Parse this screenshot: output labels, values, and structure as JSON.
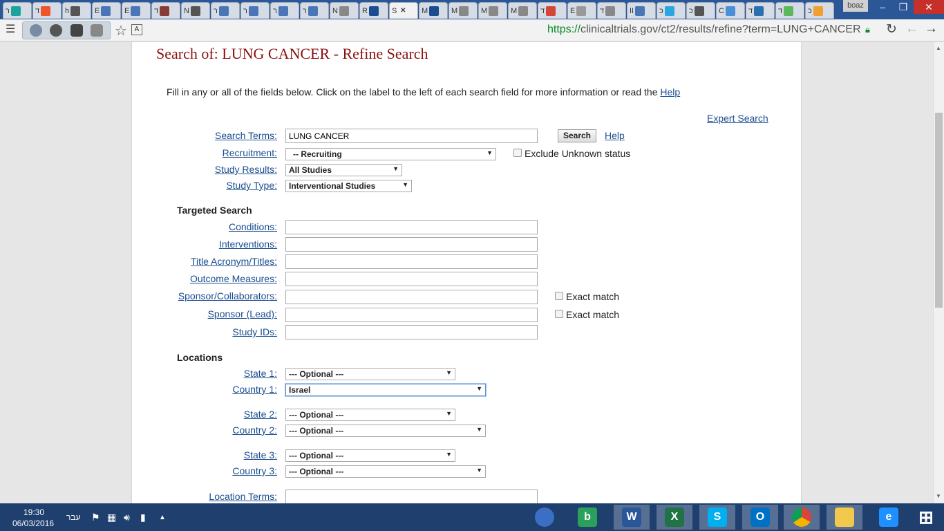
{
  "browser": {
    "tabs": [
      {
        "text": "ר",
        "icon": "m-logo-icon",
        "color": "#1ba39c"
      },
      {
        "text": "ד",
        "icon": "d-logo-icon",
        "color": "#f0542c"
      },
      {
        "text": "h",
        "icon": "window-icon",
        "color": "#555555"
      },
      {
        "text": "E",
        "icon": "waveform-icon",
        "color": "#4a76b8"
      },
      {
        "text": "E",
        "icon": "waveform-icon",
        "color": "#4a76b8"
      },
      {
        "text": "ד",
        "icon": "image-icon",
        "color": "#8b3a3a"
      },
      {
        "text": "N",
        "icon": "s-logo-icon",
        "color": "#555555"
      },
      {
        "text": "ר",
        "icon": "waveform-icon",
        "color": "#4a76b8"
      },
      {
        "text": "ר",
        "icon": "waveform-icon",
        "color": "#4a76b8"
      },
      {
        "text": "ר",
        "icon": "waveform-icon",
        "color": "#4a76b8"
      },
      {
        "text": "ר",
        "icon": "waveform-icon",
        "color": "#4a76b8"
      },
      {
        "text": "N",
        "icon": "page-icon",
        "color": "#888888"
      },
      {
        "text": "R",
        "icon": "m-logo-icon",
        "color": "#1a4d8f"
      },
      {
        "text": "S",
        "icon": "close-icon",
        "color": "#444444",
        "active": true
      },
      {
        "text": "M",
        "icon": "l-logo-icon",
        "color": "#1a4d8f"
      },
      {
        "text": "M",
        "icon": "page-icon",
        "color": "#888888"
      },
      {
        "text": "M",
        "icon": "page-icon",
        "color": "#888888"
      },
      {
        "text": "M",
        "icon": "page-icon",
        "color": "#888888"
      },
      {
        "text": "ד",
        "icon": "gmail-icon",
        "color": "#d44638"
      },
      {
        "text": "E",
        "icon": "loading-icon",
        "color": "#999999"
      },
      {
        "text": "ד",
        "icon": "page-icon",
        "color": "#888888"
      },
      {
        "text": "II",
        "icon": "waveform-icon",
        "color": "#4a76b8"
      },
      {
        "text": "כ",
        "icon": "n-logo-icon",
        "color": "#2aa7e0"
      },
      {
        "text": "כ",
        "icon": "window-icon",
        "color": "#555555"
      },
      {
        "text": "C",
        "icon": "at-logo-icon",
        "color": "#4a90d9"
      },
      {
        "text": "ד",
        "icon": "camera-icon",
        "color": "#2a6fb0"
      },
      {
        "text": "ד",
        "icon": "m-logo-icon",
        "color": "#5cb85c"
      },
      {
        "text": "כ",
        "icon": "chart-icon",
        "color": "#f0a030"
      }
    ],
    "user_badge": "boaz",
    "url_scheme": "https://",
    "url_rest": "clinicaltrials.gov/ct2/results/refine?term=LUNG+CANCER"
  },
  "page": {
    "title": "Search of: LUNG CANCER - Refine Search",
    "instructions_text": "Fill in any or all of the fields below. Click on the label to the left of each search field for more information or read the ",
    "instructions_link": "Help",
    "expert_search": "Expert Search",
    "fields": {
      "search_terms_label": "Search Terms:",
      "search_terms_value": "LUNG CANCER",
      "search_button": "Search",
      "help_link": "Help",
      "recruitment_label": "Recruitment:",
      "recruitment_value": "-- Recruiting",
      "exclude_unknown": "Exclude Unknown status",
      "study_results_label": "Study Results:",
      "study_results_value": "All Studies",
      "study_type_label": "Study Type:",
      "study_type_value": "Interventional Studies"
    },
    "targeted": {
      "heading": "Targeted Search",
      "conditions": "Conditions:",
      "interventions": "Interventions:",
      "title_acronym": "Title Acronym/Titles:",
      "outcome_measures": "Outcome Measures:",
      "sponsor_collaborators": "Sponsor/Collaborators:",
      "sponsor_lead": "Sponsor (Lead):",
      "study_ids": "Study IDs:",
      "exact_match_1": "Exact match",
      "exact_match_2": "Exact match"
    },
    "locations": {
      "heading": "Locations",
      "state1_label": "State 1:",
      "state1_value": "--- Optional ---",
      "country1_label": "Country 1:",
      "country1_value": "Israel",
      "state2_label": "State 2:",
      "state2_value": "--- Optional ---",
      "country2_label": "Country 2:",
      "country2_value": "--- Optional ---",
      "state3_label": "State 3:",
      "state3_value": "--- Optional ---",
      "country3_label": "Country 3:",
      "country3_value": "--- Optional ---",
      "location_terms_label": "Location Terms:"
    }
  },
  "taskbar": {
    "time": "19:30",
    "date": "06/03/2016",
    "language": "עבר",
    "apps": [
      {
        "icon": "globe-app-icon",
        "color": "#3a6fc4",
        "label": ""
      },
      {
        "icon": "b-app-icon",
        "color": "#2aa05a",
        "label": "b"
      },
      {
        "icon": "word-icon",
        "color": "#2b579a",
        "label": "W"
      },
      {
        "icon": "excel-icon",
        "color": "#217346",
        "label": "X"
      },
      {
        "icon": "skype-icon",
        "color": "#00aff0",
        "label": "S"
      },
      {
        "icon": "outlook-icon",
        "color": "#0072c6",
        "label": "O"
      },
      {
        "icon": "chrome-icon",
        "color": "#db4437",
        "label": ""
      },
      {
        "icon": "file-explorer-icon",
        "color": "#f2c94c",
        "label": ""
      },
      {
        "icon": "internet-explorer-icon",
        "color": "#1e90ff",
        "label": "e"
      },
      {
        "icon": "windows-start-icon",
        "color": "#ffffff",
        "label": ""
      }
    ]
  }
}
